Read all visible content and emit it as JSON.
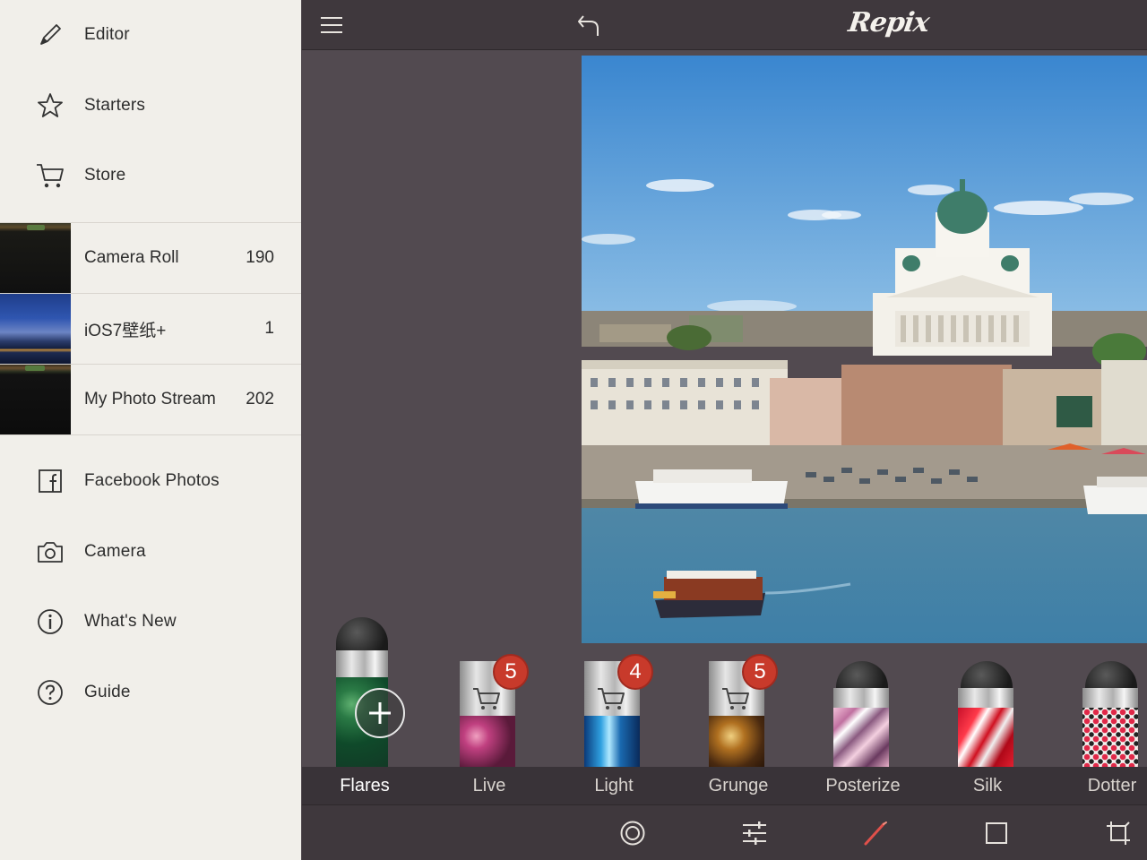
{
  "sidebar": {
    "items": [
      {
        "label": "Editor",
        "icon": "pencil-icon"
      },
      {
        "label": "Starters",
        "icon": "star-icon"
      },
      {
        "label": "Store",
        "icon": "cart-icon"
      }
    ],
    "albums": [
      {
        "label": "Camera Roll",
        "count": "190"
      },
      {
        "label": "iOS7壁纸+",
        "count": "1"
      },
      {
        "label": "My Photo Stream",
        "count": "202"
      }
    ],
    "sources": [
      {
        "label": "Facebook Photos",
        "icon": "facebook-icon"
      },
      {
        "label": "Camera",
        "icon": "camera-icon"
      },
      {
        "label": "What's New",
        "icon": "info-icon"
      },
      {
        "label": "Guide",
        "icon": "help-icon"
      }
    ]
  },
  "topbar": {
    "logo": "Repix",
    "menu_icon": "hamburger-icon",
    "undo_icon": "undo-icon"
  },
  "brushes": [
    {
      "label": "Flares",
      "badge": null,
      "locked": false,
      "active": true
    },
    {
      "label": "Live",
      "badge": "5",
      "locked": true,
      "active": false
    },
    {
      "label": "Light",
      "badge": "4",
      "locked": true,
      "active": false
    },
    {
      "label": "Grunge",
      "badge": "5",
      "locked": true,
      "active": false
    },
    {
      "label": "Posterize",
      "badge": null,
      "locked": false,
      "active": false
    },
    {
      "label": "Silk",
      "badge": null,
      "locked": false,
      "active": false
    },
    {
      "label": "Dotter",
      "badge": null,
      "locked": false,
      "active": false
    }
  ],
  "toolbar": {
    "tools": [
      "vignette-icon",
      "adjust-sliders-icon",
      "brush-icon",
      "frame-icon",
      "crop-icon"
    ],
    "active_tool": "brush-icon"
  },
  "colors": {
    "sidebar_bg": "#f1efea",
    "main_bg": "#524a50",
    "bar_bg": "#3f383d",
    "badge": "#c83a2b",
    "active_tool": "#e0504a"
  }
}
